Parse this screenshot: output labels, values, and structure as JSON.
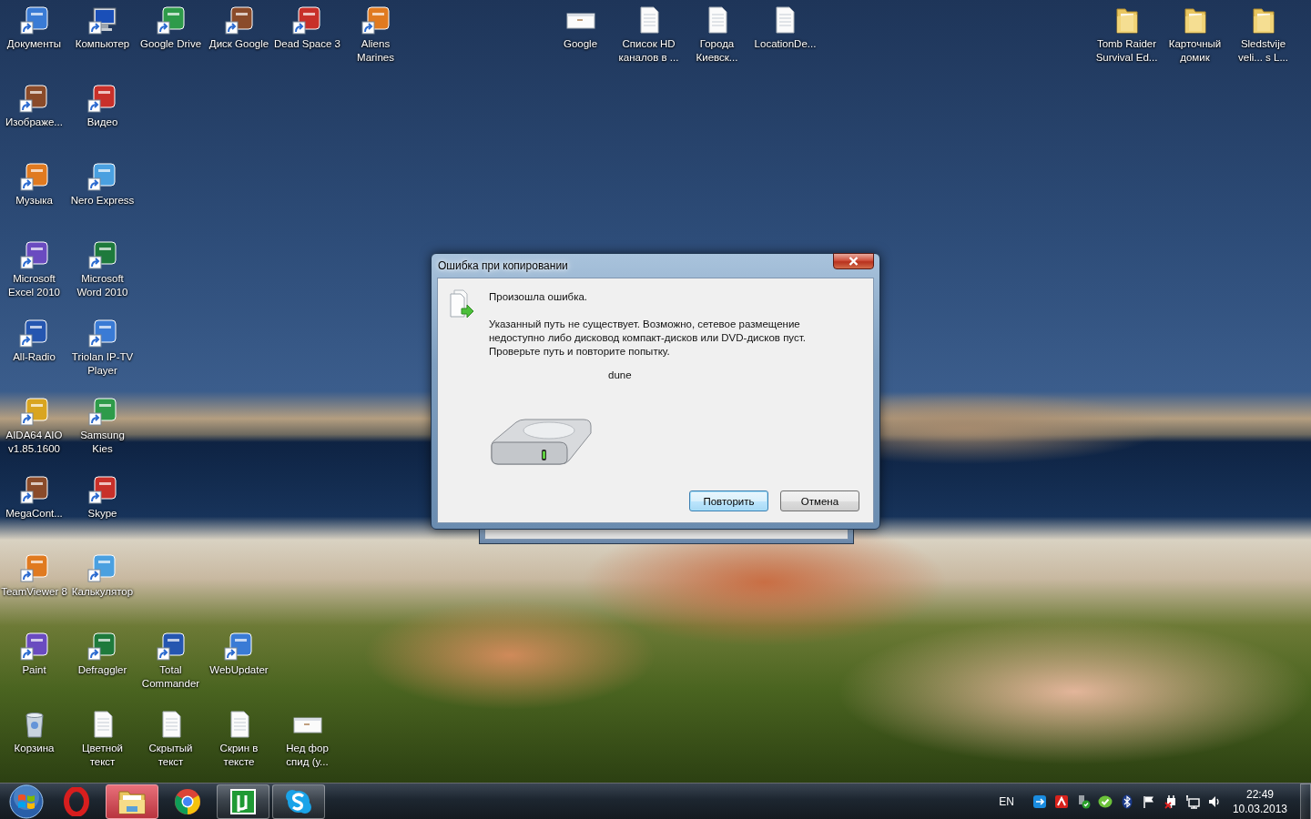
{
  "desktop": {
    "icons": [
      {
        "label": "Документы",
        "kind": "shortcut"
      },
      {
        "label": "Компьютер",
        "kind": "computer"
      },
      {
        "label": "Google Drive",
        "kind": "shortcut"
      },
      {
        "label": "Диск Google",
        "kind": "shortcut"
      },
      {
        "label": "Dead Space 3",
        "kind": "shortcut"
      },
      {
        "label": "Aliens Marines",
        "kind": "shortcut"
      },
      {
        "label": "Google",
        "kind": "page"
      },
      {
        "label": "Список HD каналов в ...",
        "kind": "document"
      },
      {
        "label": "Города Киевск...",
        "kind": "document"
      },
      {
        "label": "LocationDe...",
        "kind": "document"
      },
      {
        "label": "Tomb Raider Survival Ed...",
        "kind": "folder"
      },
      {
        "label": "Карточный домик",
        "kind": "folder"
      },
      {
        "label": "Sledstvije veli... s L...",
        "kind": "folder"
      },
      {
        "label": "Изображе...",
        "kind": "shortcut"
      },
      {
        "label": "Видео",
        "kind": "shortcut"
      },
      {
        "label": "Музыка",
        "kind": "shortcut"
      },
      {
        "label": "Nero Express",
        "kind": "shortcut"
      },
      {
        "label": "Microsoft Excel 2010",
        "kind": "shortcut"
      },
      {
        "label": "Microsoft Word 2010",
        "kind": "shortcut"
      },
      {
        "label": "All-Radio",
        "kind": "shortcut"
      },
      {
        "label": "Triolan IP-TV Player",
        "kind": "shortcut"
      },
      {
        "label": "AIDA64 AIO v1.85.1600",
        "kind": "shortcut"
      },
      {
        "label": "Samsung Kies",
        "kind": "shortcut"
      },
      {
        "label": "MegaCont...",
        "kind": "shortcut"
      },
      {
        "label": "Skype",
        "kind": "shortcut"
      },
      {
        "label": "TeamViewer 8",
        "kind": "shortcut"
      },
      {
        "label": "Калькулятор",
        "kind": "shortcut"
      },
      {
        "label": "Paint",
        "kind": "shortcut"
      },
      {
        "label": "Defraggler",
        "kind": "shortcut"
      },
      {
        "label": "Total Commander",
        "kind": "shortcut"
      },
      {
        "label": "WebUpdater",
        "kind": "shortcut"
      },
      {
        "label": "Корзина",
        "kind": "trash"
      },
      {
        "label": "Цветной текст",
        "kind": "document"
      },
      {
        "label": "Скрытый текст",
        "kind": "document"
      },
      {
        "label": "Скрин в тексте",
        "kind": "document"
      },
      {
        "label": "Нед фор спид (у...",
        "kind": "page"
      }
    ]
  },
  "dialog": {
    "title": "Ошибка при копировании",
    "heading": "Произошла ошибка.",
    "message": "Указанный путь не существует. Возможно, сетевое размещение недоступно либо дисковод компакт-дисков или DVD-дисков пуст. Проверьте путь и повторите попытку.",
    "item_name": "dune",
    "buttons": [
      {
        "label": "Повторить",
        "default": true
      },
      {
        "label": "Отмена",
        "default": false
      }
    ]
  },
  "taskbar": {
    "buttons": [
      {
        "running": false,
        "highlighted": false
      },
      {
        "running": true,
        "highlighted": true
      },
      {
        "running": false,
        "highlighted": false
      },
      {
        "running": true,
        "highlighted": false
      },
      {
        "running": true,
        "highlighted": false
      }
    ],
    "language": "EN",
    "time": "22:49",
    "date": "10.03.2013"
  }
}
